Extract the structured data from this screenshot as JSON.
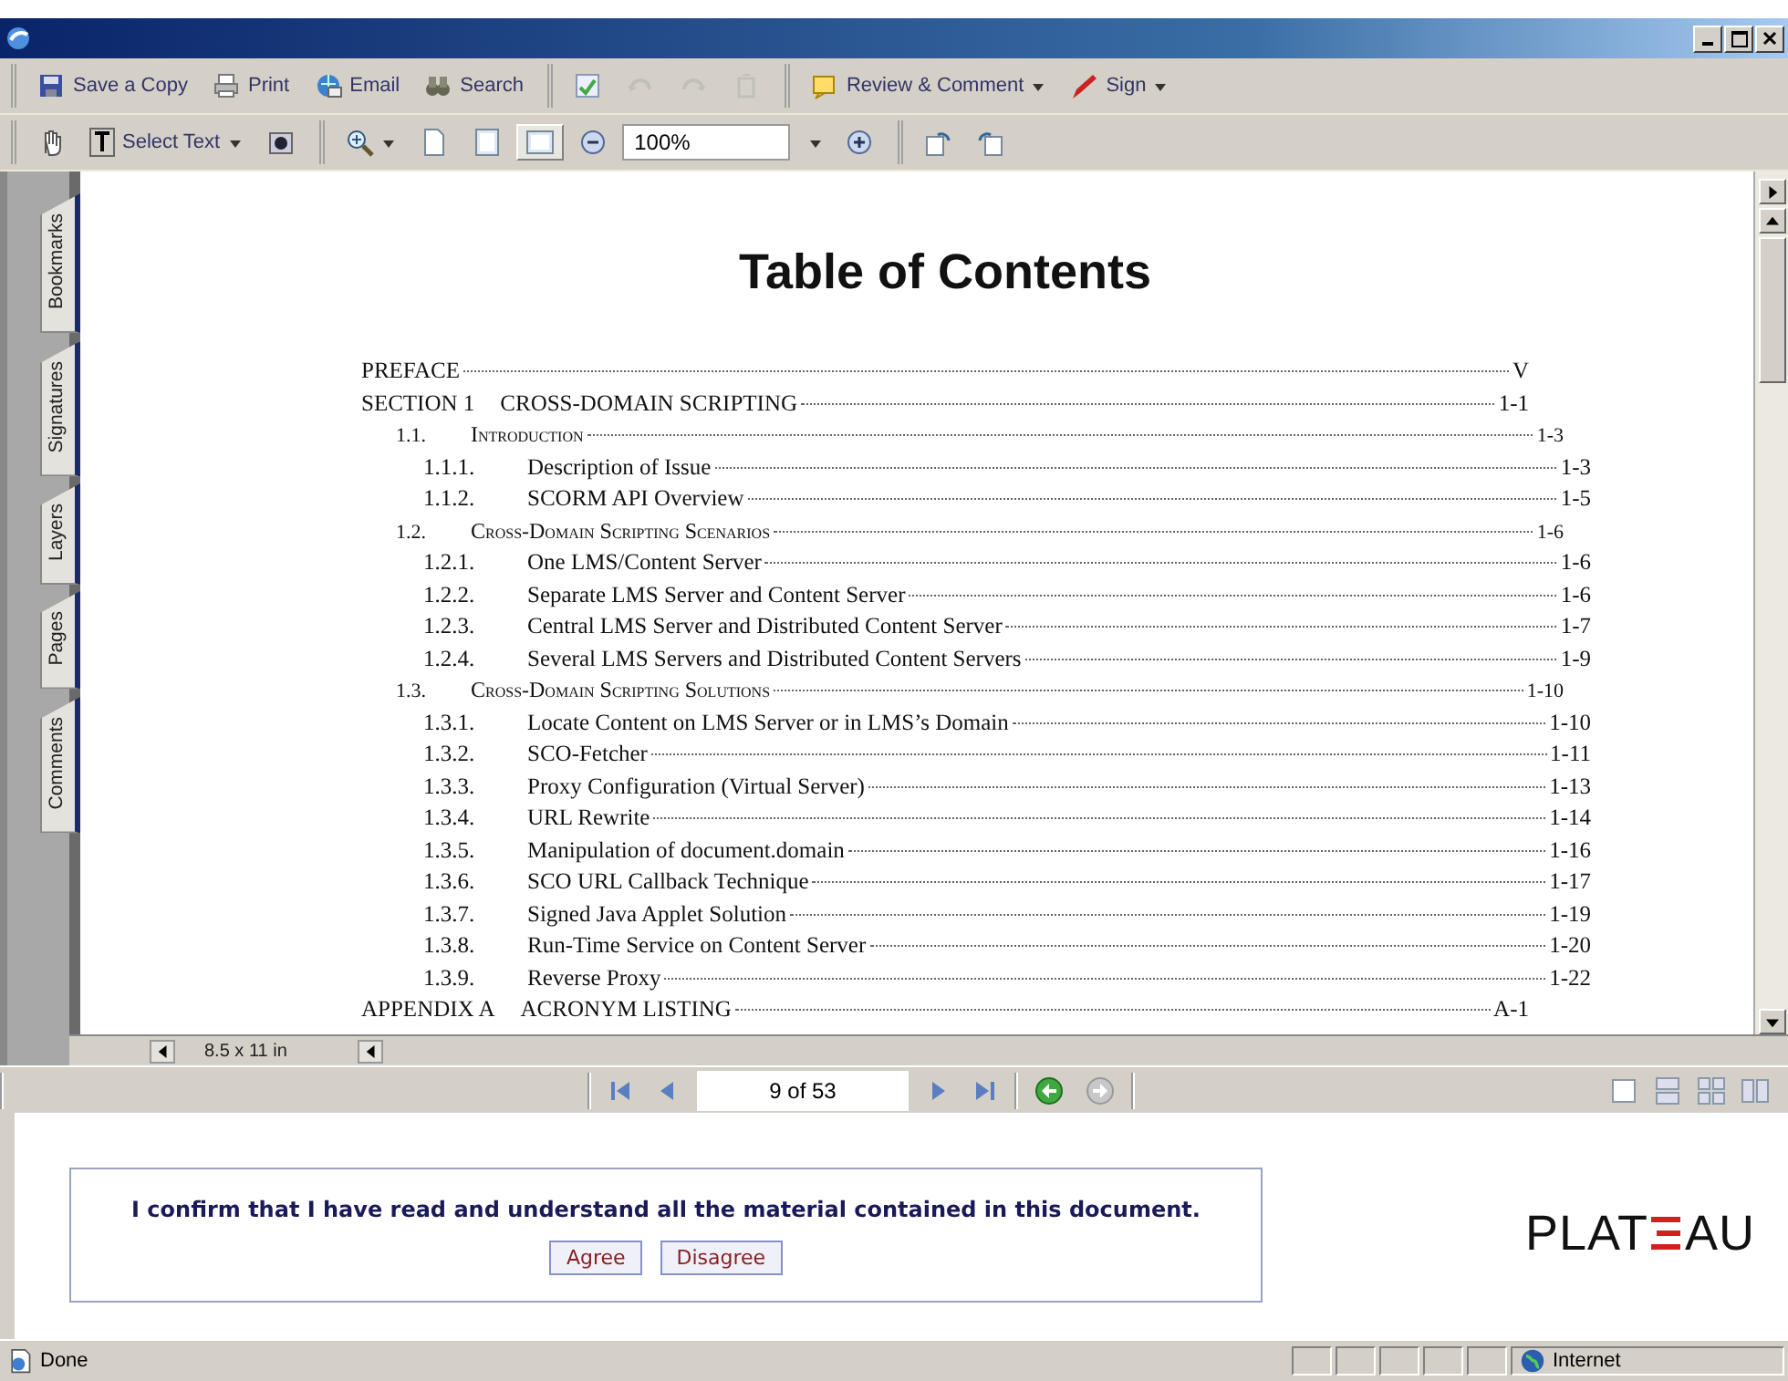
{
  "toolbar_1": {
    "groups": [
      [
        {
          "kind": "tool",
          "label": "Save a Copy"
        },
        {
          "kind": "tool",
          "label": "Print"
        },
        {
          "kind": "tool",
          "label": "Email"
        },
        {
          "kind": "tool",
          "label": "Search"
        }
      ],
      [
        {
          "kind": "tool",
          "disabled": false
        },
        {
          "kind": "tool",
          "disabled": true
        },
        {
          "kind": "tool",
          "disabled": true
        },
        {
          "kind": "tool",
          "disabled": true
        }
      ],
      [
        {
          "kind": "tool",
          "label": "Review & Comment",
          "menu": true
        },
        {
          "kind": "tool",
          "label": "Sign",
          "menu": true
        }
      ]
    ]
  },
  "toolbar_2": {
    "groups": [
      [
        {
          "kind": "tool"
        },
        {
          "kind": "tool",
          "label": "Select Text",
          "menu": true
        },
        {
          "kind": "tool"
        }
      ],
      [
        {
          "kind": "tool",
          "menu": true
        },
        {
          "kind": "tool",
          "selected": false
        },
        {
          "kind": "tool",
          "selected": false
        },
        {
          "kind": "tool",
          "selected": true
        },
        {
          "kind": "tool"
        },
        {
          "kind": "field",
          "value": "100%",
          "menu": true
        },
        {
          "kind": "tool"
        }
      ],
      [
        {
          "kind": "tool"
        },
        {
          "kind": "tool"
        }
      ]
    ]
  },
  "side_tabs": [
    {
      "label": "Bookmarks"
    },
    {
      "label": "Signatures"
    },
    {
      "label": "Layers"
    },
    {
      "label": "Pages"
    },
    {
      "label": "Comments"
    }
  ],
  "document": {
    "heading": "Table of Contents",
    "toc": [
      {
        "title": "PREFACE",
        "page": "V"
      },
      {
        "number": "SECTION 1",
        "title": "CROSS-DOMAIN SCRIPTING",
        "page": "1-1",
        "children": [
          {
            "number": "1.1.",
            "title": "Introduction",
            "page": "1-3",
            "children": [
              {
                "number": "1.1.1.",
                "title": "Description of Issue",
                "page": "1-3"
              },
              {
                "number": "1.1.2.",
                "title": "SCORM API Overview",
                "page": "1-5"
              }
            ]
          },
          {
            "number": "1.2.",
            "title": "Cross-Domain Scripting Scenarios",
            "page": "1-6",
            "children": [
              {
                "number": "1.2.1.",
                "title": "One LMS/Content Server",
                "page": "1-6"
              },
              {
                "number": "1.2.2.",
                "title": "Separate LMS Server and Content Server",
                "page": "1-6"
              },
              {
                "number": "1.2.3.",
                "title": "Central LMS Server and Distributed Content Server",
                "page": "1-7"
              },
              {
                "number": "1.2.4.",
                "title": "Several LMS Servers and Distributed Content Servers",
                "page": "1-9"
              }
            ]
          },
          {
            "number": "1.3.",
            "title": "Cross-Domain Scripting Solutions",
            "page": "1-10",
            "children": [
              {
                "number": "1.3.1.",
                "title": "Locate Content on LMS Server or in LMS’s Domain",
                "page": "1-10"
              },
              {
                "number": "1.3.2.",
                "title": "SCO-Fetcher",
                "page": "1-11"
              },
              {
                "number": "1.3.3.",
                "title": "Proxy Configuration (Virtual Server)",
                "page": "1-13"
              },
              {
                "number": "1.3.4.",
                "title": "URL Rewrite",
                "page": "1-14"
              },
              {
                "number": "1.3.5.",
                "title": "Manipulation of document.domain",
                "page": "1-16"
              },
              {
                "number": "1.3.6.",
                "title": "SCO URL Callback Technique",
                "page": "1-17"
              },
              {
                "number": "1.3.7.",
                "title": "Signed Java Applet Solution",
                "page": "1-19"
              },
              {
                "number": "1.3.8.",
                "title": "Run-Time Service on Content Server",
                "page": "1-20"
              },
              {
                "number": "1.3.9.",
                "title": "Reverse Proxy",
                "page": "1-22"
              }
            ]
          }
        ]
      },
      {
        "number": "APPENDIX A",
        "title": "ACRONYM LISTING",
        "page": "A-1"
      }
    ],
    "page_size": "8.5 x 11 in"
  },
  "navigation": {
    "page_field": "9 of 53",
    "back": {
      "disabled": false
    },
    "forward": {
      "disabled": true
    }
  },
  "confirmation": {
    "message": "I confirm that I have read and understand all the material contained in this document.",
    "buttons": [
      "Agree",
      "Disagree"
    ]
  },
  "logo": {
    "text_start": "PLAT",
    "text_end": "AU"
  },
  "status_bar": {
    "text": "Done",
    "zone": "Internet"
  }
}
